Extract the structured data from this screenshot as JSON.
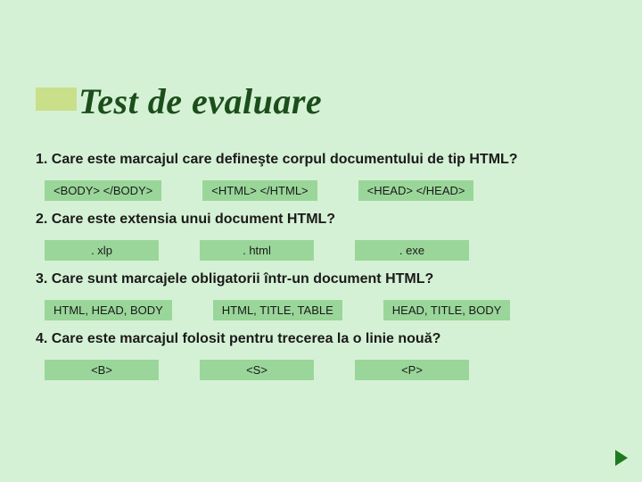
{
  "title": "Test de evaluare",
  "questions": [
    {
      "num": "1.",
      "text": "Care este marcajul care defineşte corpul documentului de tip HTML?",
      "options": [
        "<BODY> </BODY>",
        "<HTML> </HTML>",
        "<HEAD> </HEAD>"
      ]
    },
    {
      "num": "2.",
      "text": "Care este extensia unui document HTML?",
      "options": [
        ". xlp",
        ". html",
        ". exe"
      ]
    },
    {
      "num": "3.",
      "text": "Care sunt marcajele obligatorii într-un document HTML?",
      "options": [
        "HTML, HEAD, BODY",
        "HTML, TITLE, TABLE",
        "HEAD, TITLE, BODY"
      ]
    },
    {
      "num": "4.",
      "text": "Care este marcajul folosit pentru trecerea la o linie nouă?",
      "options": [
        "<B>",
        "<S>",
        "<P>"
      ]
    }
  ],
  "nav": {
    "next": "next"
  }
}
